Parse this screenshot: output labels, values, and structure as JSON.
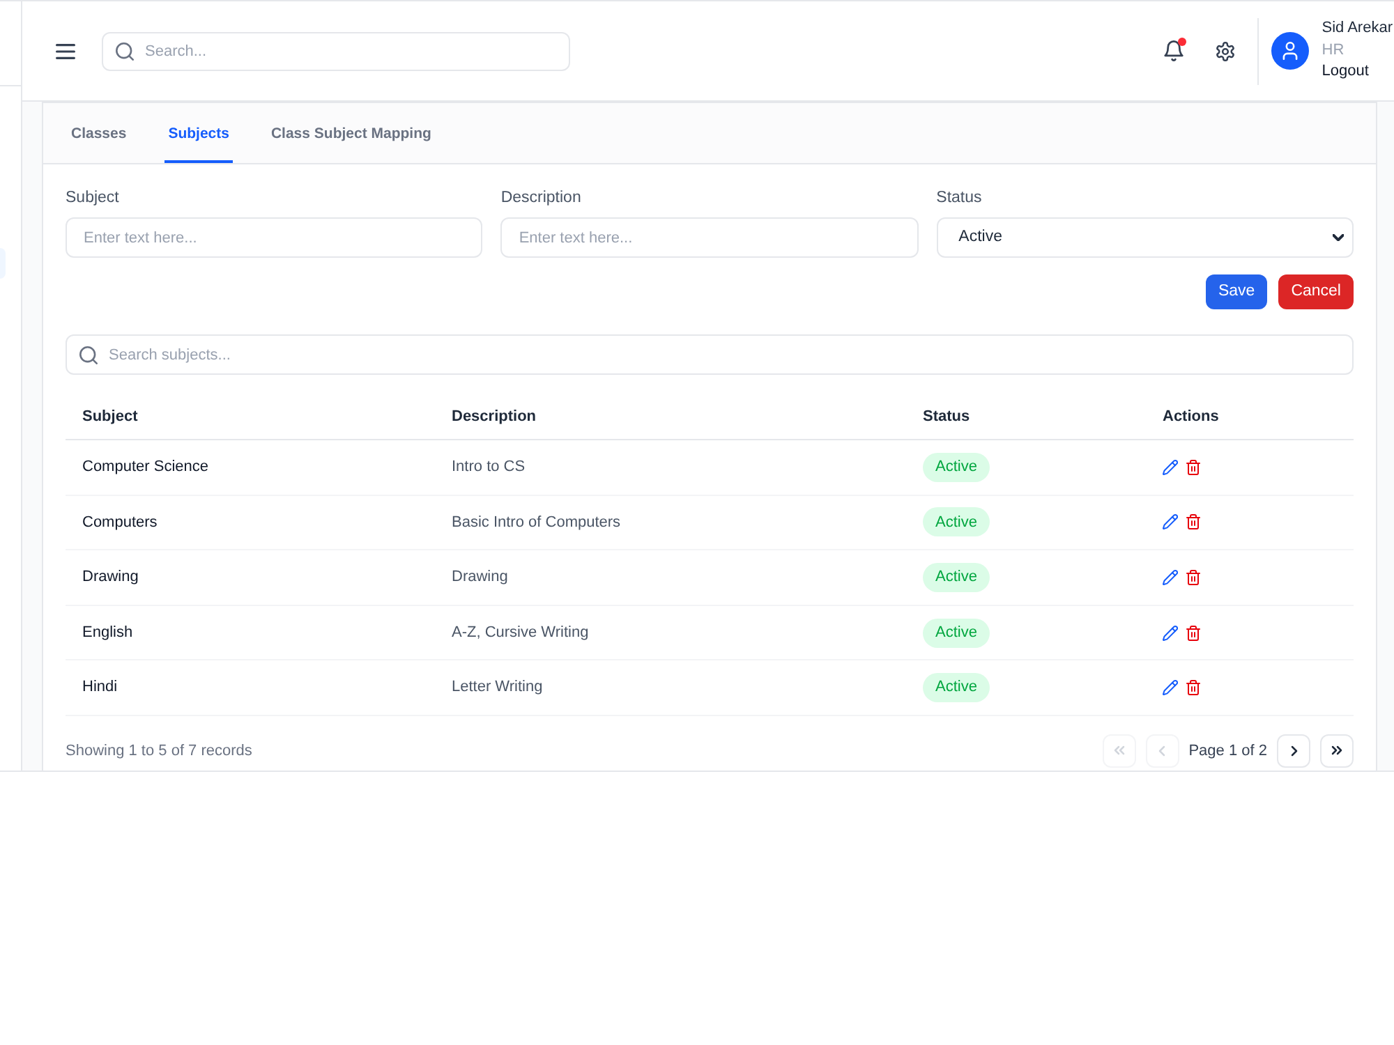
{
  "sidebar": {
    "items": [
      {
        "selected": true
      }
    ]
  },
  "header": {
    "search": {
      "placeholder": "Search..."
    },
    "notifications": {
      "unread": true
    },
    "user": {
      "name": "Sid Arekar",
      "role": "HR",
      "logout": "Logout"
    }
  },
  "tabs": [
    {
      "label": "Classes",
      "selected": false
    },
    {
      "label": "Subjects",
      "selected": true
    },
    {
      "label": "Class Subject Mapping",
      "selected": false
    }
  ],
  "form": {
    "fields": [
      {
        "kind": "text",
        "label": "Subject",
        "placeholder": "Enter text here..."
      },
      {
        "kind": "text",
        "label": "Description",
        "placeholder": "Enter text here..."
      },
      {
        "kind": "select",
        "label": "Status",
        "value": "Active"
      }
    ],
    "buttons": [
      {
        "kind": "primary",
        "label": "Save"
      },
      {
        "kind": "danger",
        "label": "Cancel"
      }
    ]
  },
  "table": {
    "search": {
      "placeholder": "Search subjects..."
    },
    "columns": [
      "Subject",
      "Description",
      "Status",
      "Actions"
    ],
    "rows": [
      {
        "subject": "Computer Science",
        "description": "Intro to CS",
        "status": "Active"
      },
      {
        "subject": "Computers",
        "description": "Basic Intro of Computers",
        "status": "Active"
      },
      {
        "subject": "Drawing",
        "description": "Drawing",
        "status": "Active"
      },
      {
        "subject": "English",
        "description": "A-Z, Cursive Writing",
        "status": "Active"
      },
      {
        "subject": "Hindi",
        "description": "Letter Writing",
        "status": "Active"
      }
    ]
  },
  "pagination": {
    "summary": "Showing 1 to 5 of 7 records",
    "controls": [
      {
        "kind": "first",
        "disabled": true
      },
      {
        "kind": "prev",
        "disabled": true
      },
      {
        "kind": "page",
        "label": "Page 1 of 2"
      },
      {
        "kind": "next",
        "disabled": false
      },
      {
        "kind": "last",
        "disabled": false
      }
    ]
  }
}
